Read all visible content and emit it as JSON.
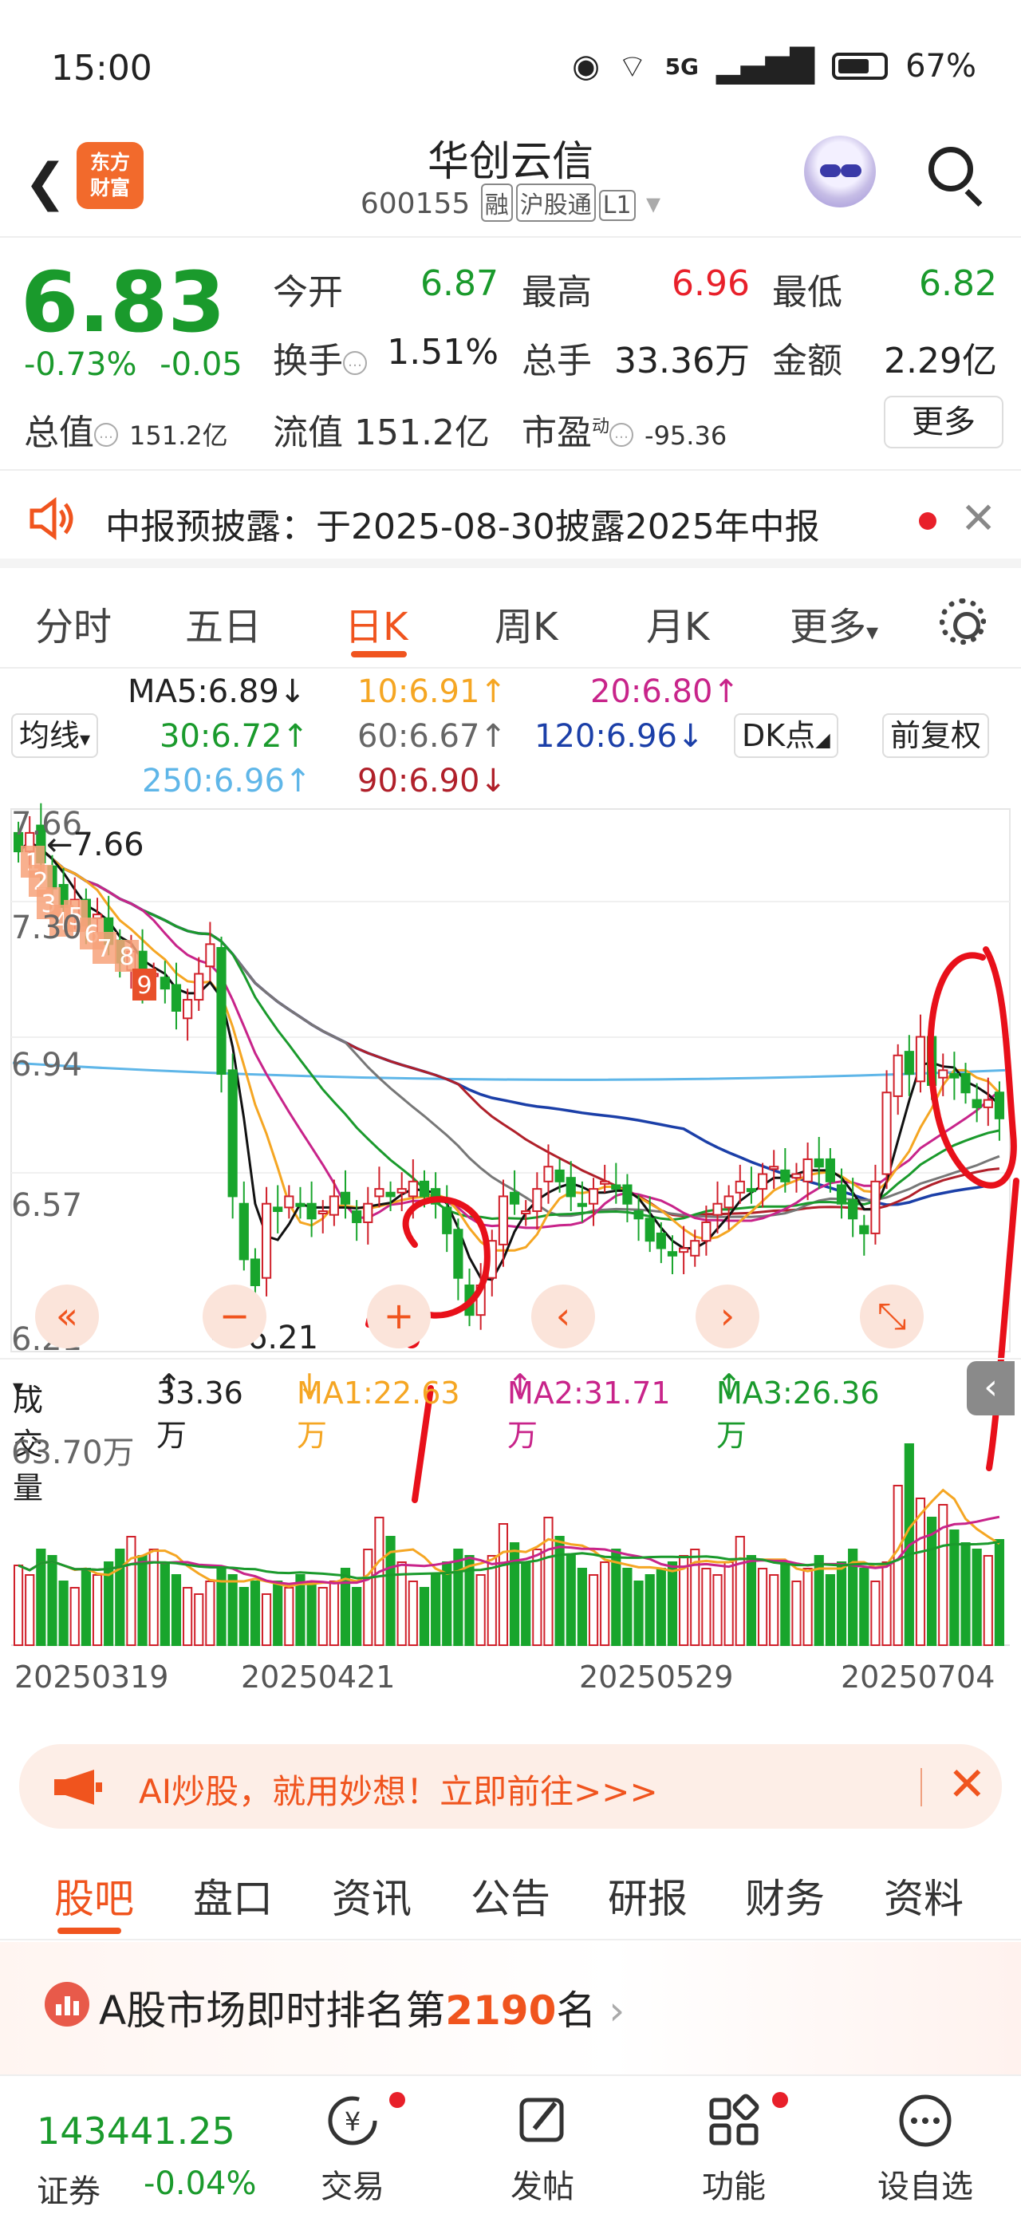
{
  "status_bar": {
    "time": "15:00",
    "network": "5G",
    "battery": "67%",
    "battery_level": 0.67
  },
  "header": {
    "logo_line1": "东方",
    "logo_line2": "财富",
    "stock_name": "华创云信",
    "stock_code": "600155",
    "tags": [
      "融",
      "沪股通",
      "L1"
    ]
  },
  "quote": {
    "price": "6.83",
    "change_pct": "-0.73%",
    "change": "-0.05",
    "open_label": "今开",
    "open": "6.87",
    "high_label": "最高",
    "high": "6.96",
    "low_label": "最低",
    "low": "6.82",
    "turnover_label": "换手",
    "turnover": "1.51%",
    "volume_label": "总手",
    "volume": "33.36万",
    "amount_label": "金额",
    "amount": "2.29亿",
    "mktcap_label": "总值",
    "mktcap": "151.2亿",
    "float_label": "流值",
    "float": "151.2亿",
    "pe_label": "市盈",
    "pe_sup": "动",
    "pe": "-95.36",
    "more": "更多"
  },
  "notice": {
    "text": "中报预披露：于2025-08-30披露2025年中报"
  },
  "period_tabs": [
    "分时",
    "五日",
    "日K",
    "周K",
    "月K",
    "更多"
  ],
  "active_period": "日K",
  "ma_legend": {
    "selector": "均线",
    "ma5": "MA5:6.89",
    "ma10": "10:6.91",
    "ma20": "20:6.80",
    "ma30": "30:6.72",
    "ma60": "60:6.67",
    "ma120": "120:6.96",
    "ma250": "250:6.96",
    "ma90": "90:6.90",
    "dk": "DK点",
    "adjust": "前复权"
  },
  "chart_data": {
    "type": "candlestick",
    "ylabels": [
      "7.66",
      "7.30",
      "6.94",
      "6.57",
      "6.21"
    ],
    "ylim": [
      6.21,
      7.66
    ],
    "high_marker": "7.66",
    "low_marker": "<-6.21",
    "x_labels": [
      "20250319",
      "20250421",
      "20250529",
      "20250704"
    ],
    "volume_series_name": "成交量",
    "volume": "33.36万",
    "vol_ma1": "MA1:22.63万",
    "vol_ma2": "MA2:31.71万",
    "vol_ma3": "MA3:26.36万",
    "vol_max": "63.70万",
    "events": [
      "1",
      "2",
      "3",
      "4",
      "5",
      "6",
      "7",
      "8",
      "9"
    ],
    "closes": [
      7.55,
      7.6,
      7.52,
      7.45,
      7.4,
      7.42,
      7.35,
      7.38,
      7.3,
      7.25,
      7.28,
      7.2,
      7.22,
      7.18,
      7.12,
      7.15,
      7.22,
      7.3,
      6.95,
      6.62,
      6.45,
      6.38,
      6.6,
      6.58,
      6.62,
      6.6,
      6.56,
      6.58,
      6.62,
      6.6,
      6.55,
      6.6,
      6.64,
      6.62,
      6.64,
      6.66,
      6.62,
      6.6,
      6.52,
      6.4,
      6.3,
      6.38,
      6.5,
      6.62,
      6.6,
      6.58,
      6.64,
      6.7,
      6.66,
      6.62,
      6.6,
      6.64,
      6.66,
      6.64,
      6.6,
      6.56,
      6.5,
      6.48,
      6.46,
      6.48,
      6.5,
      6.55,
      6.6,
      6.62,
      6.66,
      6.64,
      6.68,
      6.7,
      6.66,
      6.68,
      6.72,
      6.7,
      6.66,
      6.6,
      6.56,
      6.52,
      6.66,
      6.9,
      7.0,
      6.95,
      7.05,
      6.92,
      6.96,
      6.94,
      6.9,
      6.86,
      6.88,
      6.83
    ],
    "volumes": [
      25,
      22,
      30,
      28,
      20,
      18,
      24,
      22,
      26,
      30,
      34,
      28,
      30,
      26,
      22,
      18,
      16,
      20,
      24,
      22,
      18,
      20,
      16,
      20,
      18,
      22,
      20,
      18,
      20,
      24,
      18,
      30,
      40,
      34,
      26,
      20,
      18,
      22,
      26,
      30,
      28,
      22,
      28,
      38,
      32,
      26,
      30,
      40,
      34,
      28,
      24,
      22,
      26,
      30,
      24,
      20,
      22,
      24,
      26,
      28,
      30,
      24,
      22,
      26,
      34,
      28,
      24,
      22,
      26,
      20,
      24,
      28,
      22,
      26,
      30,
      24,
      20,
      26,
      50,
      63,
      46,
      40,
      44,
      36,
      32,
      30,
      28,
      33
    ]
  },
  "chart_controls": [
    "«",
    "−",
    "+",
    "‹",
    "›",
    "⤡"
  ],
  "ad": {
    "text": "AI炒股，就用妙想！立即前往>>>"
  },
  "sub_tabs": [
    "股吧",
    "盘口",
    "资讯",
    "公告",
    "研报",
    "财务",
    "资料"
  ],
  "rank": {
    "prefix": "A股市场即时排名第",
    "number": "2190",
    "suffix": "名"
  },
  "bottom_nav": {
    "index_value": "143441.25",
    "index_label": "证券",
    "index_change": "-0.04%",
    "items": [
      "交易",
      "发帖",
      "功能",
      "设自选"
    ]
  }
}
